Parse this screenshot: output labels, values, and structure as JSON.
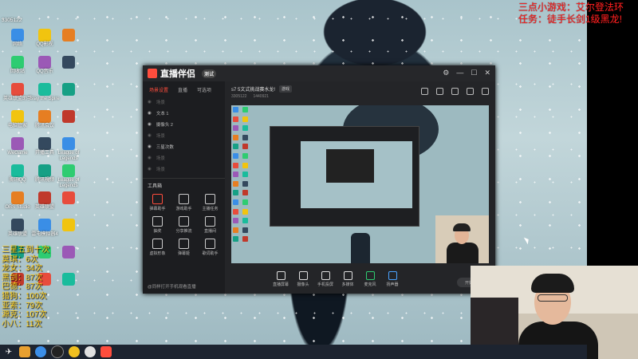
{
  "overlay": {
    "line1": "三点小游戏：艾尔登法环",
    "line2": "任务：徒手长剑1级黑龙!"
  },
  "left_overlay": {
    "title": "三星五到十次",
    "rows": [
      "莫琪：6次",
      "龙女：34次",
      "黑剑：87次",
      "巴德：87次",
      "猎狗：100次",
      "亚索：79次",
      "源克：107次",
      "小八：11次"
    ]
  },
  "desktop": {
    "top_left_text": "3305122",
    "icons_col1": [
      "网络",
      "回收站",
      "英雄联盟助手",
      "电脑管家",
      "WeGame",
      "腾讯QQ",
      "OBS Studio",
      "英雄联盟",
      "",
      ""
    ],
    "icons_col2": [
      "QQ影视",
      "QQ音乐",
      "Slay the Spire",
      "腾讯会议",
      "开播工具",
      "腾讯视频",
      "英雄联盟",
      "雷电模拟器4",
      "",
      ""
    ],
    "icons_col3": [
      "",
      "",
      "",
      "",
      "League of Legends",
      "League of Legends",
      "",
      "",
      "",
      ""
    ]
  },
  "app": {
    "name": "直播伴侣",
    "version": "测试",
    "sidebar_tabs": [
      "场景设置",
      "直播",
      "可选项"
    ],
    "scenes": [
      "场景",
      "文本 1",
      "摄像头 2",
      "场景",
      "三星次数",
      "场景",
      "场景"
    ],
    "tools_title": "工具箱",
    "tools": [
      "弹幕助手",
      "游戏助手",
      "主播任务",
      "抽奖",
      "分享推流",
      "直播间",
      "虚拟形象",
      "弹幕姬",
      "歌词助手"
    ],
    "tip": "@同样打开手机观看直播",
    "stream_title": "s7 5文式挑战赛水龙!",
    "stream_badge": "游戏",
    "sub_line1": "3305122",
    "sub_line2": "1440921",
    "controls": [
      "直播屏幕",
      "摄像头",
      "手机投屏",
      "多媒体",
      "麦克风",
      "扬声器"
    ],
    "go_live": "开始直播"
  },
  "taskbar": {
    "items": [
      "start",
      "folder",
      "chrome",
      "obs",
      "app",
      "app2"
    ]
  }
}
